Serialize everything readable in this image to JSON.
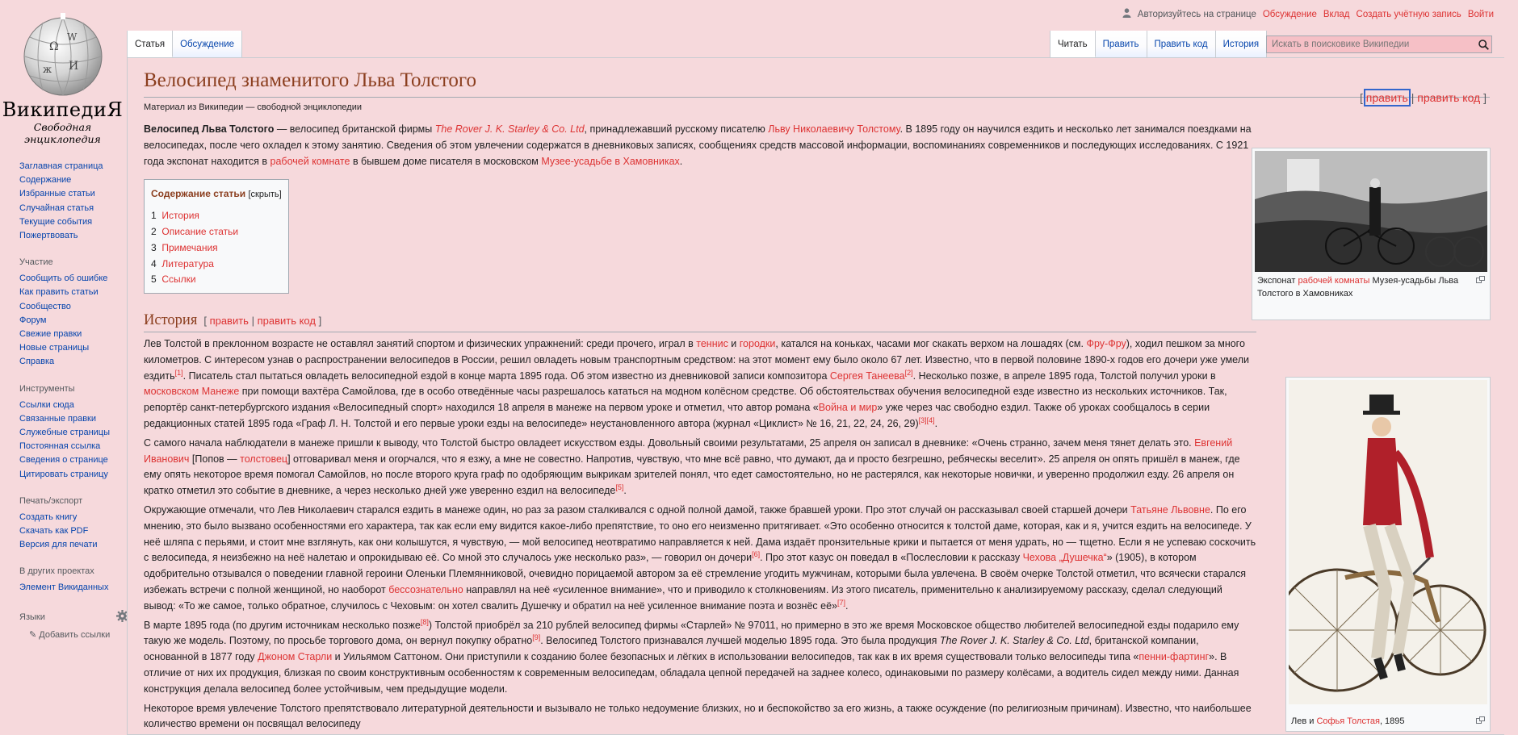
{
  "personal": {
    "login_note": "Авторизуйтесь на странице",
    "discussion": "Обсуждение",
    "contrib": "Вклад",
    "create_account": "Создать учётную запись",
    "login": "Войти"
  },
  "logo": {
    "wordmark": "ВикипедиЯ",
    "tagline": "Свободная энциклопедия"
  },
  "sidebar": {
    "nav": [
      "Заглавная страница",
      "Содержание",
      "Избранные статьи",
      "Случайная статья",
      "Текущие события",
      "Пожертвовать"
    ],
    "participate_heading": "Участие",
    "participate": [
      "Сообщить об ошибке",
      "Как править статьи",
      "Сообщество",
      "Форум",
      "Свежие правки",
      "Новые страницы",
      "Справка"
    ],
    "tools_heading": "Инструменты",
    "tools": [
      "Ссылки сюда",
      "Связанные правки",
      "Служебные страницы",
      "Постоянная ссылка",
      "Сведения о странице",
      "Цитировать страницу"
    ],
    "print_heading": "Печать/экспорт",
    "print": [
      "Создать книгу",
      "Скачать как PDF",
      "Версия для печати"
    ],
    "other_heading": "В других проектах",
    "other": [
      "Элемент Викиданных"
    ],
    "languages_heading": "Языки",
    "add_links": "Добавить ссылки"
  },
  "tabs": {
    "article": "Статья",
    "talk": "Обсуждение",
    "read": "Читать",
    "edit": "Править",
    "edit_source": "Править код",
    "history": "История"
  },
  "search": {
    "placeholder": "Искать в поисковике Википедии"
  },
  "article": {
    "title": "Велосипед знаменитого Льва Толстого",
    "subtitle": "Материал из Википедии — свободной энциклопедии",
    "edit_label": "править",
    "edit_source_label": "править код",
    "intro_bold": "Велосипед Льва Толстого",
    "intro_1": " — велосипед британской фирмы ",
    "intro_link_1": "The Rover J. K. Starley & Co. Ltd",
    "intro_2": ", принадлежавший русскому писателю ",
    "intro_link_2": "Льву Николаевичу Толстому",
    "intro_3": ". В 1895 году он научился ездить и несколько лет занимался поездками на велосипедах, после чего охладел к этому занятию. Сведения об этом увлечении содержатся в дневниковых записях, сообщениях средств массовой информации, воспоминаниях современников и последующих исследованиях. С 1921 года экспонат находится в ",
    "intro_link_3": "рабочей комнате",
    "intro_4": " в бывшем доме писателя в московском ",
    "intro_link_4": "Музее-усадьбе в Хамовниках",
    "intro_5": ".",
    "toc_title": "Содержание статьи",
    "toc_hide": "скрыть",
    "toc": [
      {
        "num": "1",
        "label": "История"
      },
      {
        "num": "2",
        "label": "Описание статьи"
      },
      {
        "num": "3",
        "label": "Примечания"
      },
      {
        "num": "4",
        "label": "Литература"
      },
      {
        "num": "5",
        "label": "Ссылки"
      }
    ],
    "history_heading": "История",
    "p1": {
      "a": "Лев Толстой в преклонном возрасте не оставлял занятий спортом и физических упражнений: среди прочего, играл в ",
      "l1": "теннис",
      "b": " и ",
      "l2": "городки",
      "c": ", катался на коньках, часами мог скакать верхом на лошадях (см. ",
      "l3": "Фру-Фру",
      "d": "), ходил пешком за много километров. С интересом узнав о распространении велосипедов в России, решил овладеть новым транспортным средством: на этот момент ему было около 67 лет. Известно, что в первой половине 1890-х годов его дочери уже умели ездить",
      "s1": "[1]",
      "e": ". Писатель стал пытаться овладеть велосипедной ездой в конце марта 1895 года. Об этом известно из дневниковой записи композитора ",
      "l4": "Сергея Танеева",
      "s2": "[2]",
      "f": ". Несколько позже, в апреле 1895 года, Толстой получил уроки в ",
      "l5": "московском Манеже",
      "g": " при помощи вахтёра Самойлова, где в особо отведённые часы разрешалось кататься на модном колёсном средстве. Об обстоятельствах обучения велосипедной езде известно из нескольких источников. Так, репортёр санкт-петербургского издания «Велосипедный спорт» находился 18 апреля в манеже на первом уроке и отметил, что автор романа «",
      "l6": "Война и мир",
      "h": "» уже через час свободно ездил. Также об уроках сообщалось в серии редакционных статей 1895 года «Граф Л. Н. Толстой и его первые уроки езды на велосипеде» неустановленного автора (журнал «Циклист» № 16, 21, 22, 24, 26, 29)",
      "s3": "[3][4]",
      "i": "."
    },
    "p2": {
      "a": "С самого начала наблюдатели в манеже пришли к выводу, что Толстой быстро овладеет искусством езды. Довольный своими результатами, 25 апреля он записал в дневнике: «Очень странно, зачем меня тянет делать это. ",
      "l1": "Евгений Иванович",
      "b": " [Попов — ",
      "l2": "толстовец",
      "c": "] отговаривал меня и огорчался, что я езжу, а мне не совестно. Напротив, чувствую, что мне всё равно, что думают, да и просто безгрешно, ребяческы веселит». 25 апреля он опять пришёл в манеж, где ему опять некоторое время помогал Самойлов, но после второго круга граф по одобряющим выкрикам зрителей понял, что едет самостоятельно, но не растерялся, как некоторые новички, и уверенно продолжил езду. 26 апреля он кратко отметил это событие в дневнике, а через несколько дней уже уверенно ездил на велосипеде",
      "s1": "[5]",
      "d": "."
    },
    "p3": {
      "a": "Окружающие отмечали, что Лев Николаевич старался ездить в манеже один, но раз за разом сталкивался с одной полной дамой, также бравшей уроки. Про этот случай он рассказывал своей старшей дочери ",
      "l1": "Татьяне Львовне",
      "b": ". По его мнению, это было вызвано особенностями его характера, так как если ему видится какое-либо препятствие, то оно его неизменно притягивает. «Это особенно относится к толстой даме, которая, как и я, учится ездить на велосипеде. У неё шляпа с перьями, и стоит мне взглянуть, как они колышутся, я чувствую, — мой велосипед неотвратимо направляется к ней. Дама издаёт пронзительные крики и пытается от меня удрать, но — тщетно. Если я не успеваю соскочить с велосипеда, я неизбежно на неё налетаю и опрокидываю её. Со мной это случалось уже несколько раз», — говорил он дочери",
      "s1": "[6]",
      "c": ". Про этот казус он поведал в «Послесловии к рассказу ",
      "l2": "Чехова „Душечка“",
      "d": "» (1905), в котором одобрительно отзывался о поведении главной героини Оленьки Племянниковой, очевидно порицаемой автором за её стремление угодить мужчинам, которыми была увлечена. В своём очерке Толстой отметил, что всячески старался избежать встречи с полной женщиной, но наоборот ",
      "l3": "бессознательно",
      "e": " направлял на неё «усиленное внимание», что и приводило к столкновениям. Из этого писатель, применительно к анализируемому рассказу, сделал следующий вывод: «То же самое, только обратное, случилось с Чеховым: он хотел свалить Душечку и обратил на неё усиленное внимание поэта и вознёс её»",
      "s2": "[7]",
      "f": "."
    },
    "p4": {
      "a": "В марте 1895 года (по другим источникам несколько позже",
      "s1": "[8]",
      "b": ") Толстой приобрёл за 210 рублей велосипед фирмы «Старлей» № 97011, но примерно в это же время Московское общество любителей велосипедной езды подарило ему такую же модель. Поэтому, по просьбе торгового дома, он вернул покупку обратно",
      "s2": "[9]",
      "c": ". Велосипед Толстого признавался лучшей моделью 1895 года. Это была продукция ",
      "it": "The Rover J. K. Starley & Co. Ltd",
      "d": ", британской компании, основанной в 1877 году ",
      "l1": "Джоном Старли",
      "e": " и Уильямом Саттоном. Они приступили к созданию более безопасных и лёгких в использовании велосипедов, так как в их время существовали только велосипеды типа «",
      "l2": "пенни-фартинг",
      "f": "». В отличие от них их продукция, близкая по своим конструктивным особенностям к современным велосипедам, обладала цепной передачей на заднее колесо, одинаковыми по размеру колёсами, а водитель сидел между ними. Данная конструкция делала велосипед более устойчивым, чем предыдущие модели."
    },
    "p5": {
      "a": "Некоторое время увлечение Толстого препятствовало литературной деятельности и вызывало не только недоумение близких, но и беспокойство за его жизнь, а также осуждение (по религиозным причинам). Известно, что наибольшее количество времени он посвящал велосипеду"
    }
  },
  "thumb1": {
    "cap_a": "Экспонат ",
    "cap_link": "рабочей комнаты",
    "cap_b": " Музея-усадьбы Льва Толстого в Хамовниках"
  },
  "thumb2": {
    "cap_a": "Лев и ",
    "cap_link": "Софья Толстая",
    "cap_b": ", 1895"
  }
}
